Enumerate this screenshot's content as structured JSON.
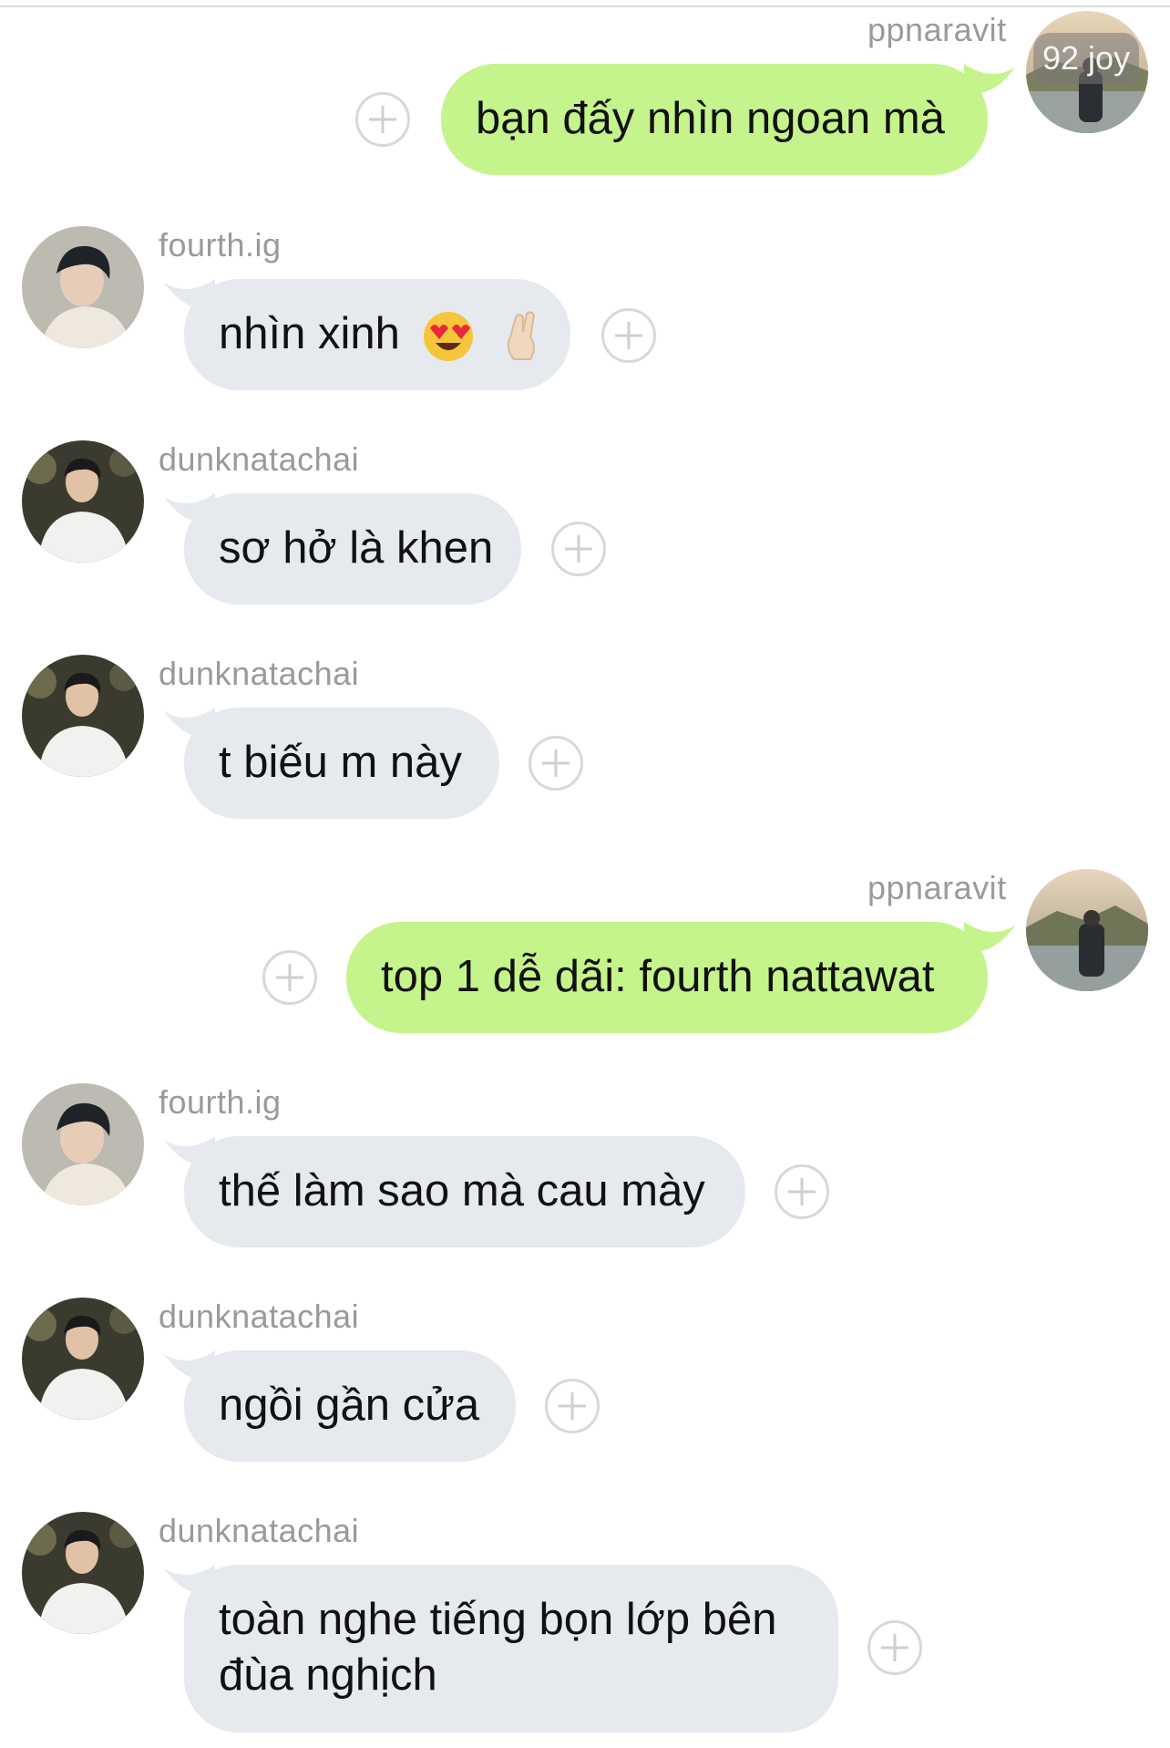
{
  "overlay_badge": "92 joy",
  "messages": [
    {
      "sender": "ppnaravit",
      "text": "bạn đấy nhìn ngoan mà",
      "direction": "outgoing"
    },
    {
      "sender": "fourth.ig",
      "text": "nhìn xinh",
      "emojis": [
        "heart-eyes-emoji",
        "crossed-fingers-emoji"
      ],
      "direction": "incoming"
    },
    {
      "sender": "dunknatachai",
      "text": "sơ hở là khen",
      "direction": "incoming"
    },
    {
      "sender": "dunknatachai",
      "text": "t biếu m này",
      "direction": "incoming"
    },
    {
      "sender": "ppnaravit",
      "text": "top 1 dễ dãi: fourth nattawat",
      "direction": "outgoing"
    },
    {
      "sender": "fourth.ig",
      "text": "thế làm sao mà cau mày",
      "direction": "incoming"
    },
    {
      "sender": "dunknatachai",
      "text": "ngồi gần cửa",
      "direction": "incoming"
    },
    {
      "sender": "dunknatachai",
      "text": "toàn nghe tiếng bọn lớp bên đùa nghịch",
      "direction": "incoming"
    }
  ],
  "colors": {
    "incoming_bubble": "#e6e9ee",
    "outgoing_bubble": "#c4f48b",
    "sender_text": "#9a9a9a",
    "message_text": "#111111"
  }
}
